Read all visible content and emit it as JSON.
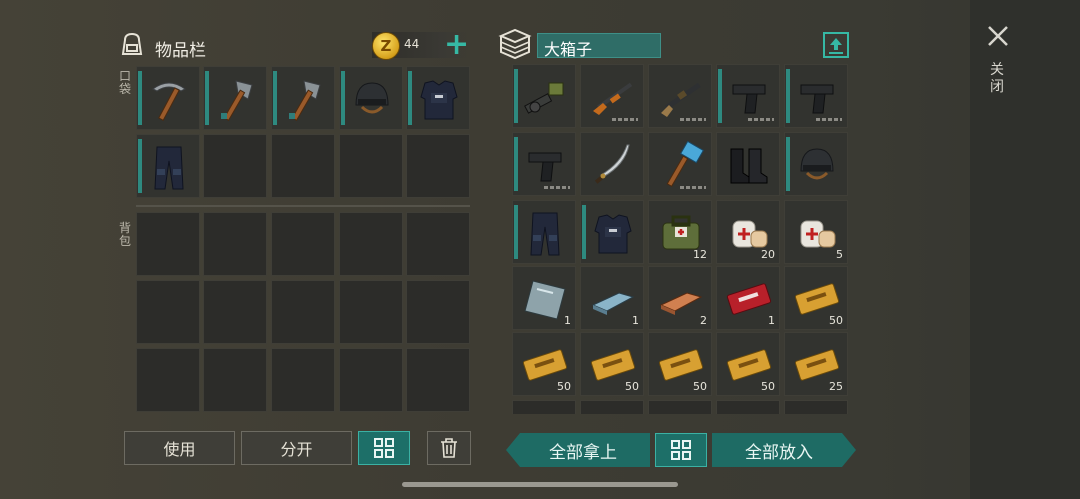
{
  "inventory": {
    "title": "物品栏",
    "coins": "44",
    "pocket_label": "口袋",
    "backpack_label": "背包"
  },
  "box": {
    "title": "大箱子"
  },
  "close": {
    "label": "关闭"
  },
  "buttons": {
    "use": "使用",
    "split": "分开",
    "take_all": "全部拿上",
    "put_all": "全部放入"
  },
  "pocket_items": [
    "pickaxe",
    "hatchet",
    "hatchet",
    "helmet",
    "body-armor",
    "armored-pants"
  ],
  "box_items": [
    {
      "name": "grenade-launcher",
      "count": ""
    },
    {
      "name": "rifle",
      "count": ""
    },
    {
      "name": "shotgun",
      "count": ""
    },
    {
      "name": "pistol",
      "count": ""
    },
    {
      "name": "pistol",
      "count": ""
    },
    {
      "name": "pistol",
      "count": ""
    },
    {
      "name": "katana",
      "count": ""
    },
    {
      "name": "sledgehammer",
      "count": ""
    },
    {
      "name": "boots",
      "count": ""
    },
    {
      "name": "helmet",
      "count": ""
    },
    {
      "name": "armored-pants",
      "count": ""
    },
    {
      "name": "body-armor",
      "count": ""
    },
    {
      "name": "medkit-bag",
      "count": "12"
    },
    {
      "name": "bandage",
      "count": "20"
    },
    {
      "name": "bandage",
      "count": "5"
    },
    {
      "name": "glass-sheet",
      "count": "1"
    },
    {
      "name": "steel-ingot",
      "count": "1"
    },
    {
      "name": "copper-ingot",
      "count": "2"
    },
    {
      "name": "combat-gear-coupon",
      "count": "1"
    },
    {
      "name": "survival-kit-coupon",
      "count": "50"
    },
    {
      "name": "survival-kit-coupon",
      "count": "50"
    },
    {
      "name": "survival-kit-coupon",
      "count": "50"
    },
    {
      "name": "survival-kit-coupon",
      "count": "50"
    },
    {
      "name": "survival-kit-coupon",
      "count": "50"
    },
    {
      "name": "survival-kit-coupon",
      "count": "25"
    }
  ]
}
